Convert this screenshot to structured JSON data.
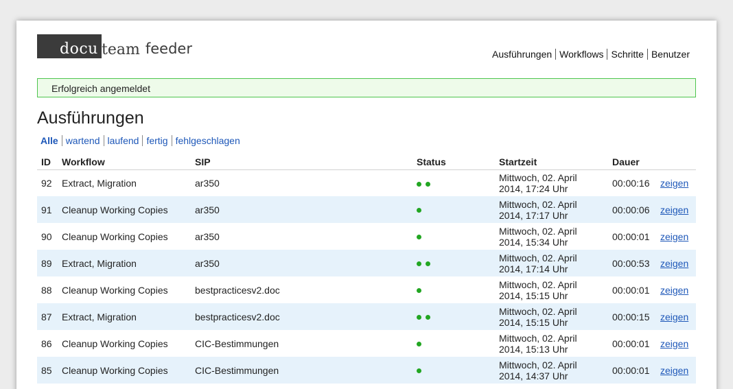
{
  "logo": {
    "part1": "docu",
    "part2": "team",
    "part3": "feeder"
  },
  "nav": [
    "Ausführungen",
    "Workflows",
    "Schritte",
    "Benutzer"
  ],
  "flash": "Erfolgreich angemeldet",
  "title": "Ausführungen",
  "filters": [
    "Alle",
    "wartend",
    "laufend",
    "fertig",
    "fehlgeschlagen"
  ],
  "columns": [
    "ID",
    "Workflow",
    "SIP",
    "Status",
    "Startzeit",
    "Dauer"
  ],
  "colors": {
    "status_dot": "#22a622",
    "link": "#1d57b8",
    "row_alt": "#e6f2fb",
    "flash_border": "#4cc44c"
  },
  "rows": [
    {
      "id": "92",
      "workflow": "Extract, Migration",
      "sip": "ar350",
      "status_dots": 2,
      "start_line1": "Mittwoch, 02. April",
      "start_line2": "2014, 17:24 Uhr",
      "duration": "00:00:16",
      "action": "zeigen"
    },
    {
      "id": "91",
      "workflow": "Cleanup Working Copies",
      "sip": "ar350",
      "status_dots": 1,
      "start_line1": "Mittwoch, 02. April",
      "start_line2": "2014, 17:17 Uhr",
      "duration": "00:00:06",
      "action": "zeigen"
    },
    {
      "id": "90",
      "workflow": "Cleanup Working Copies",
      "sip": "ar350",
      "status_dots": 1,
      "start_line1": "Mittwoch, 02. April",
      "start_line2": "2014, 15:34 Uhr",
      "duration": "00:00:01",
      "action": "zeigen"
    },
    {
      "id": "89",
      "workflow": "Extract, Migration",
      "sip": "ar350",
      "status_dots": 2,
      "start_line1": "Mittwoch, 02. April",
      "start_line2": "2014, 17:14 Uhr",
      "duration": "00:00:53",
      "action": "zeigen"
    },
    {
      "id": "88",
      "workflow": "Cleanup Working Copies",
      "sip": "bestpracticesv2.doc",
      "status_dots": 1,
      "start_line1": "Mittwoch, 02. April",
      "start_line2": "2014, 15:15 Uhr",
      "duration": "00:00:01",
      "action": "zeigen"
    },
    {
      "id": "87",
      "workflow": "Extract, Migration",
      "sip": "bestpracticesv2.doc",
      "status_dots": 2,
      "start_line1": "Mittwoch, 02. April",
      "start_line2": "2014, 15:15 Uhr",
      "duration": "00:00:15",
      "action": "zeigen"
    },
    {
      "id": "86",
      "workflow": "Cleanup Working Copies",
      "sip": "CIC-Bestimmungen",
      "status_dots": 1,
      "start_line1": "Mittwoch, 02. April",
      "start_line2": "2014, 15:13 Uhr",
      "duration": "00:00:01",
      "action": "zeigen"
    },
    {
      "id": "85",
      "workflow": "Cleanup Working Copies",
      "sip": "CIC-Bestimmungen",
      "status_dots": 1,
      "start_line1": "Mittwoch, 02. April",
      "start_line2": "2014, 14:37 Uhr",
      "duration": "00:00:01",
      "action": "zeigen"
    }
  ]
}
